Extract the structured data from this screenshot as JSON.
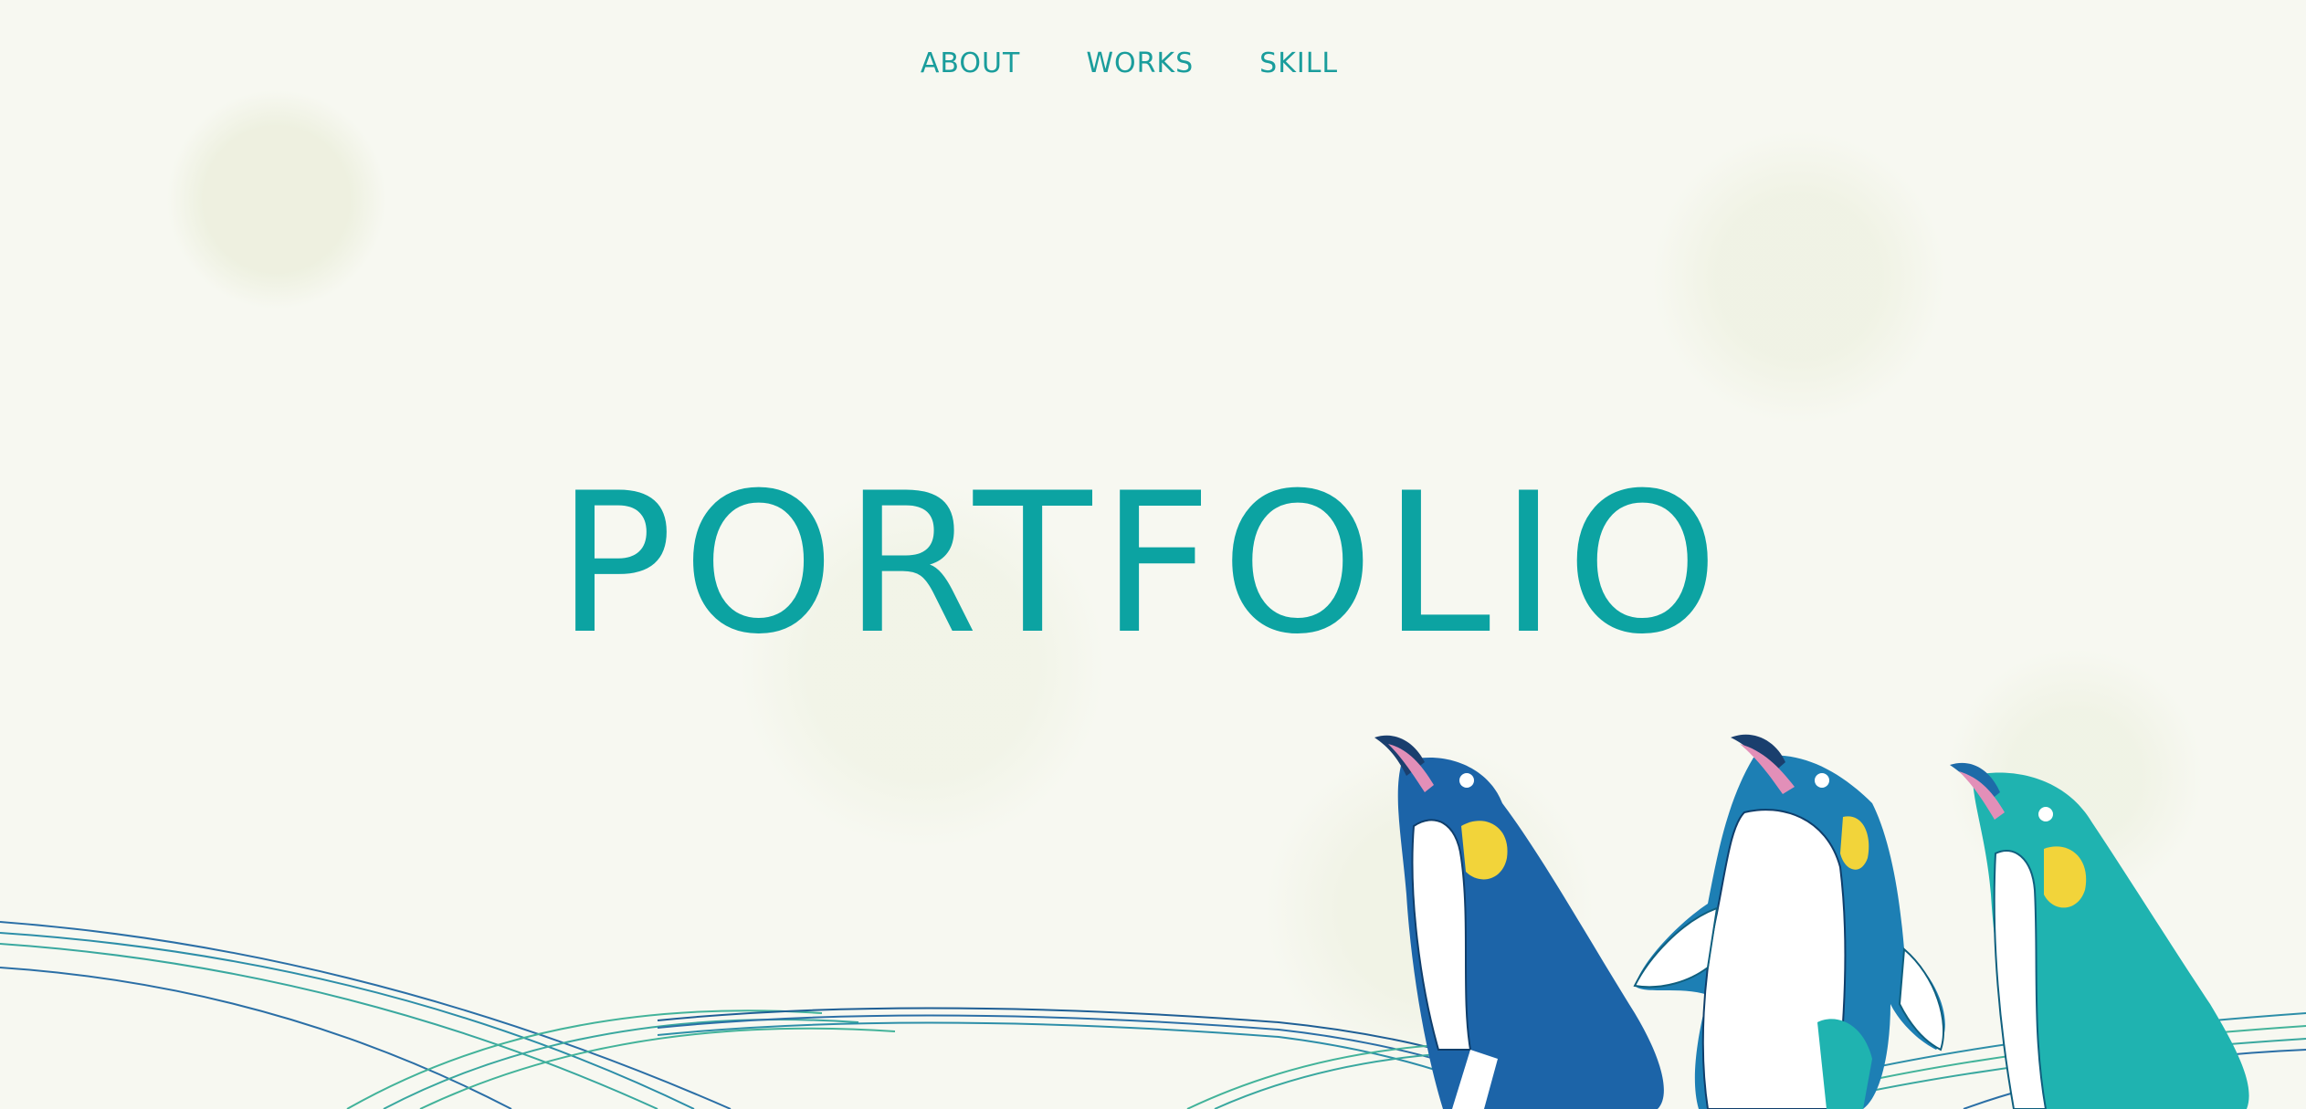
{
  "nav": {
    "items": [
      {
        "label": "ABOUT"
      },
      {
        "label": "WORKS"
      },
      {
        "label": "SKILL"
      }
    ]
  },
  "hero": {
    "title": "PORTFOLIO"
  },
  "colors": {
    "accent": "#0ca3a2",
    "background": "#f7f8f1",
    "penguin_blue": "#1c64a8",
    "penguin_teal": "#1fb3b0",
    "beak_pink": "#e28fb8",
    "cheek_yellow": "#f2d43a"
  },
  "illustration": {
    "name": "three-penguins-illustration",
    "decor": "wave-lines"
  }
}
